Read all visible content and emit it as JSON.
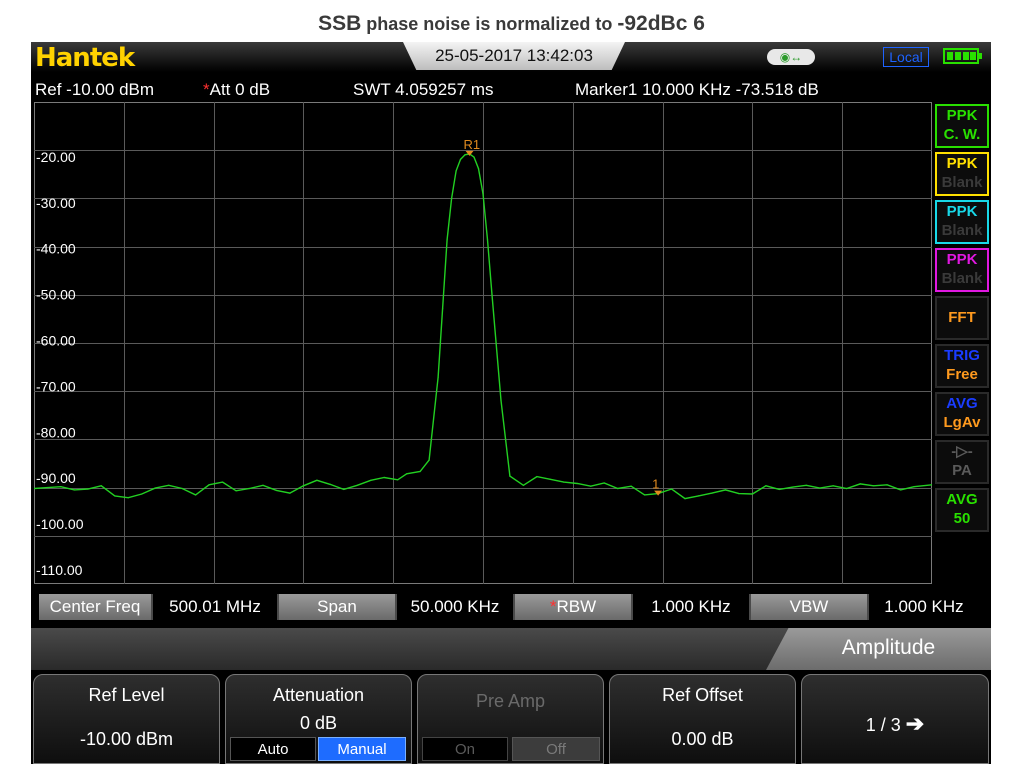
{
  "caption": {
    "part1": "SSB",
    "part2": " phase noise is normalized to ",
    "part3": "-92dBc 6"
  },
  "titlebar": {
    "logo": "Hantek",
    "datetime": "25-05-2017 13:42:03",
    "usb": "◉↔",
    "local": "Local"
  },
  "header": {
    "ref": "Ref  -10.00 dBm",
    "att_star": "*",
    "att": "Att  0 dB",
    "swt": "SWT  4.059257 ms",
    "marker": "Marker1  10.000 KHz  -73.518 dB"
  },
  "chart_data": {
    "type": "line",
    "title": "",
    "xlabel": "",
    "ylabel": "",
    "ylim": [
      -115,
      -10
    ],
    "y_ticks": [
      "-20.00",
      "-30.00",
      "-40.00",
      "-50.00",
      "-60.00",
      "-70.00",
      "-80.00",
      "-90.00",
      "-100.00",
      "-110.00"
    ],
    "y_tick_values": [
      -20,
      -30,
      -40,
      -50,
      -60,
      -70,
      -80,
      -90,
      -100,
      -110
    ],
    "grid": true,
    "x_range": [
      0,
      10
    ],
    "trace_color": "#22d022",
    "series": [
      {
        "x": [
          0.0,
          0.15,
          0.3,
          0.45,
          0.6,
          0.75,
          0.9,
          1.05,
          1.2,
          1.35,
          1.5,
          1.65,
          1.8,
          1.95,
          2.1,
          2.25,
          2.4,
          2.55,
          2.7,
          2.85,
          3.0,
          3.15,
          3.3,
          3.45,
          3.6,
          3.75,
          3.9,
          4.05,
          4.15,
          4.3,
          4.4,
          4.5,
          4.55,
          4.6,
          4.65,
          4.7,
          4.75,
          4.8,
          4.85,
          4.9,
          4.95,
          5.0,
          5.05,
          5.1,
          5.2,
          5.3,
          5.45,
          5.6,
          5.75,
          5.9,
          6.05,
          6.2,
          6.35,
          6.5,
          6.65,
          6.8,
          6.95,
          7.1,
          7.25,
          7.4,
          7.55,
          7.7,
          7.85,
          8.0,
          8.15,
          8.3,
          8.45,
          8.6,
          8.75,
          8.9,
          9.05,
          9.2,
          9.35,
          9.5,
          9.65,
          9.8,
          10.0
        ],
        "y": [
          -94.2,
          -94.0,
          -93.8,
          -94.5,
          -94.3,
          -93.6,
          -95.8,
          -96.2,
          -95.4,
          -94.1,
          -93.5,
          -94.2,
          -95.6,
          -93.4,
          -92.8,
          -94.7,
          -94.2,
          -93.5,
          -94.6,
          -95.2,
          -93.6,
          -92.4,
          -93.3,
          -94.4,
          -93.5,
          -92.4,
          -91.8,
          -92.3,
          -91.0,
          -90.5,
          -88.0,
          -70.0,
          -55.0,
          -40.0,
          -31.0,
          -25.0,
          -22.5,
          -21.5,
          -21.3,
          -22.0,
          -24.5,
          -30.0,
          -40.0,
          -52.0,
          -75.0,
          -91.5,
          -93.5,
          -91.6,
          -92.2,
          -92.8,
          -93.1,
          -93.7,
          -93.0,
          -94.2,
          -93.7,
          -95.6,
          -95.3,
          -94.3,
          -96.4,
          -95.8,
          -95.2,
          -94.5,
          -95.3,
          -95.4,
          -93.6,
          -94.4,
          -93.9,
          -93.5,
          -94.1,
          -93.6,
          -94.2,
          -93.2,
          -93.6,
          -93.4,
          -94.5,
          -93.8,
          -93.4
        ]
      }
    ],
    "markers": [
      {
        "label": "R1",
        "x": 4.85,
        "y": -21.3,
        "color": "#e08a1e"
      },
      {
        "label": "1",
        "x": 6.95,
        "y": -95.3,
        "color": "#e08a1e"
      }
    ]
  },
  "right_panel": [
    {
      "name": "ppk-cw-button",
      "line1": "PPK",
      "line2": "C. W.",
      "border": "#29e000",
      "c1": "#29e000",
      "c2": "#29e000"
    },
    {
      "name": "ppk-blank-yellow-button",
      "line1": "PPK",
      "line2": "Blank",
      "border": "#ffe000",
      "c1": "#ffe000",
      "c2": "#3a3a3a"
    },
    {
      "name": "ppk-blank-cyan-button",
      "line1": "PPK",
      "line2": "Blank",
      "border": "#18d8e8",
      "c1": "#18d8e8",
      "c2": "#3a3a3a"
    },
    {
      "name": "ppk-blank-magenta-button",
      "line1": "PPK",
      "line2": "Blank",
      "border": "#e018e0",
      "c1": "#e018e0",
      "c2": "#3a3a3a"
    },
    {
      "name": "fft-button",
      "line1": "FFT",
      "line2": "",
      "border": "#2a2a2a",
      "c1": "#ff9a1e",
      "c2": "#ff9a1e"
    },
    {
      "name": "trig-free-button",
      "line1": "TRIG",
      "line2": "Free",
      "border": "#2a2a2a",
      "c1": "#1a3cff",
      "c2": "#ff9a1e"
    },
    {
      "name": "avg-lgav-button",
      "line1": "AVG",
      "line2": "LgAv",
      "border": "#2a2a2a",
      "c1": "#1a3cff",
      "c2": "#ff9a1e"
    },
    {
      "name": "pa-button",
      "line1": "-▷-",
      "line2": "PA",
      "border": "#2a2a2a",
      "c1": "#5a5a5a",
      "c2": "#5a5a5a"
    },
    {
      "name": "avg-50-button",
      "line1": "AVG",
      "line2": "50",
      "border": "#2a2a2a",
      "c1": "#29e000",
      "c2": "#29e000"
    }
  ],
  "freqbar": {
    "center_label": "Center Freq",
    "center_value": "500.01 MHz",
    "span_label": "Span",
    "span_value": "50.000 KHz",
    "rbw_star": "*",
    "rbw_label": "RBW",
    "rbw_value": "1.000 KHz",
    "vbw_label": "VBW",
    "vbw_value": "1.000 KHz"
  },
  "menu": {
    "title": "Amplitude"
  },
  "softkeys": {
    "ref_level": {
      "title": "Ref Level",
      "value": "-10.00 dBm"
    },
    "attenuation": {
      "title": "Attenuation",
      "value": "0 dB",
      "opt_auto": "Auto",
      "opt_manual": "Manual"
    },
    "pre_amp": {
      "title": "Pre Amp",
      "opt_on": "On",
      "opt_off": "Off"
    },
    "ref_offset": {
      "title": "Ref Offset",
      "value": "0.00 dB"
    },
    "page": {
      "label": "1 / 3",
      "arrow": "➔"
    }
  }
}
